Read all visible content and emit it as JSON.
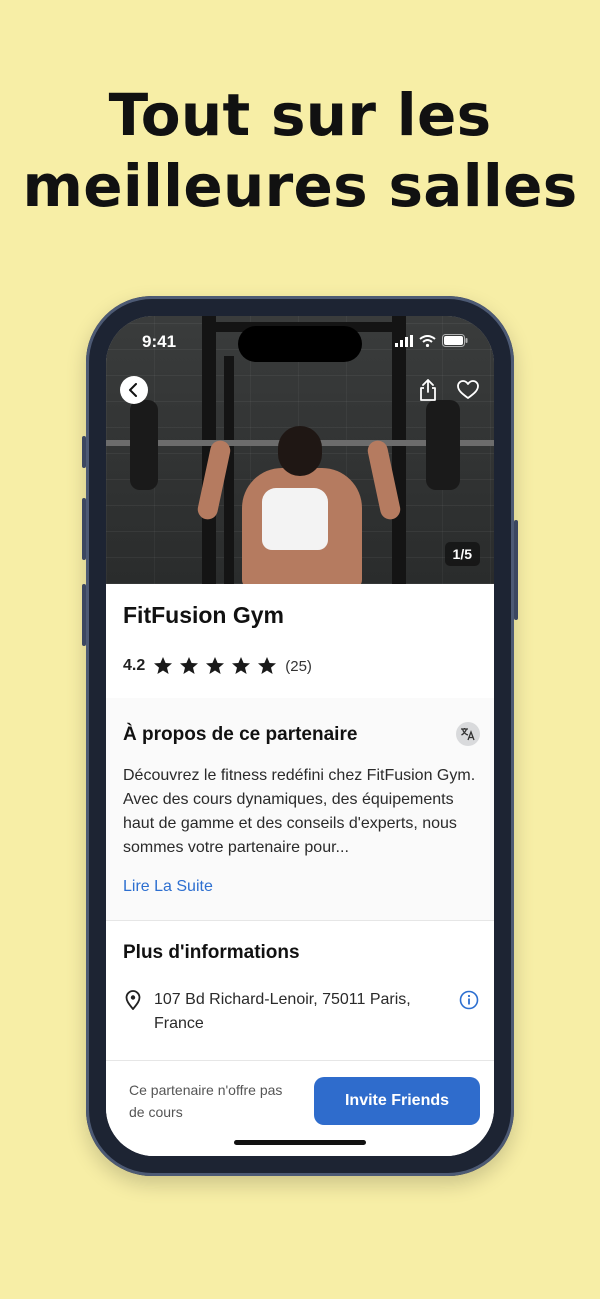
{
  "headline": {
    "line1": "Tout sur les",
    "line2": "meilleures salles"
  },
  "status_bar": {
    "time": "9:41"
  },
  "hero": {
    "page_indicator": "1/5"
  },
  "gym": {
    "name": "FitFusion Gym",
    "rating": "4.2",
    "stars": 5,
    "review_count": "(25)"
  },
  "about": {
    "title": "À propos de ce partenaire",
    "text": "Découvrez le fitness redéfini chez FitFusion Gym. Avec des cours dynamiques, des équipements haut de gamme et des conseils d'experts, nous sommes votre partenaire pour...",
    "read_more": "Lire La Suite"
  },
  "more_info": {
    "title": "Plus d'informations",
    "address": "107 Bd Richard-Lenoir, 75011 Paris, France"
  },
  "footer": {
    "no_classes": "Ce partenaire n'offre pas de cours",
    "invite_label": "Invite Friends"
  },
  "colors": {
    "background": "#f7eea6",
    "accent": "#2f6ccc",
    "link": "#2d6fd0"
  },
  "icons": [
    "back-arrow-icon",
    "share-icon",
    "heart-icon",
    "star-icon",
    "translate-icon",
    "location-pin-icon",
    "info-icon",
    "signal-icon",
    "wifi-icon",
    "battery-icon"
  ]
}
